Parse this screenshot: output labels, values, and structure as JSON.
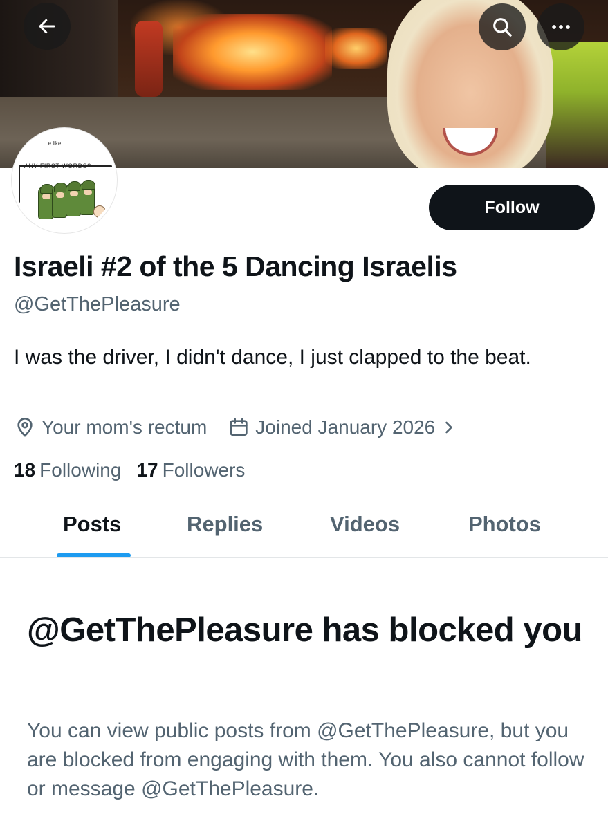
{
  "header": {
    "back_icon": "arrow-left-icon",
    "search_icon": "search-icon",
    "more_icon": "more-horizontal-icon"
  },
  "avatar": {
    "small_text": "...e like",
    "caption": "ANY FIRST WORDS?"
  },
  "profile": {
    "follow_label": "Follow",
    "display_name": "Israeli #2 of the 5 Dancing Israelis",
    "handle": "@GetThePleasure",
    "bio": "I was the driver, I didn't dance, I just clapped to the beat.",
    "location": "Your mom's rectum",
    "location_icon": "location-pin-icon",
    "joined": "Joined January 2026",
    "joined_icon": "calendar-icon",
    "joined_chevron": "chevron-right-icon",
    "following_count": "18",
    "following_label": "Following",
    "followers_count": "17",
    "followers_label": "Followers"
  },
  "tabs": [
    {
      "label": "Posts",
      "active": true
    },
    {
      "label": "Replies",
      "active": false
    },
    {
      "label": "Videos",
      "active": false
    },
    {
      "label": "Photos",
      "active": false
    }
  ],
  "blocked": {
    "title": "@GetThePleasure has blocked you",
    "description": "You can view public posts from @GetThePleasure, but you are blocked from engaging with them. You also cannot follow or message @GetThePleasure."
  },
  "colors": {
    "accent": "#1d9bf0",
    "text_primary": "#0f1419",
    "text_secondary": "#536471",
    "button_bg": "#0f1419"
  }
}
